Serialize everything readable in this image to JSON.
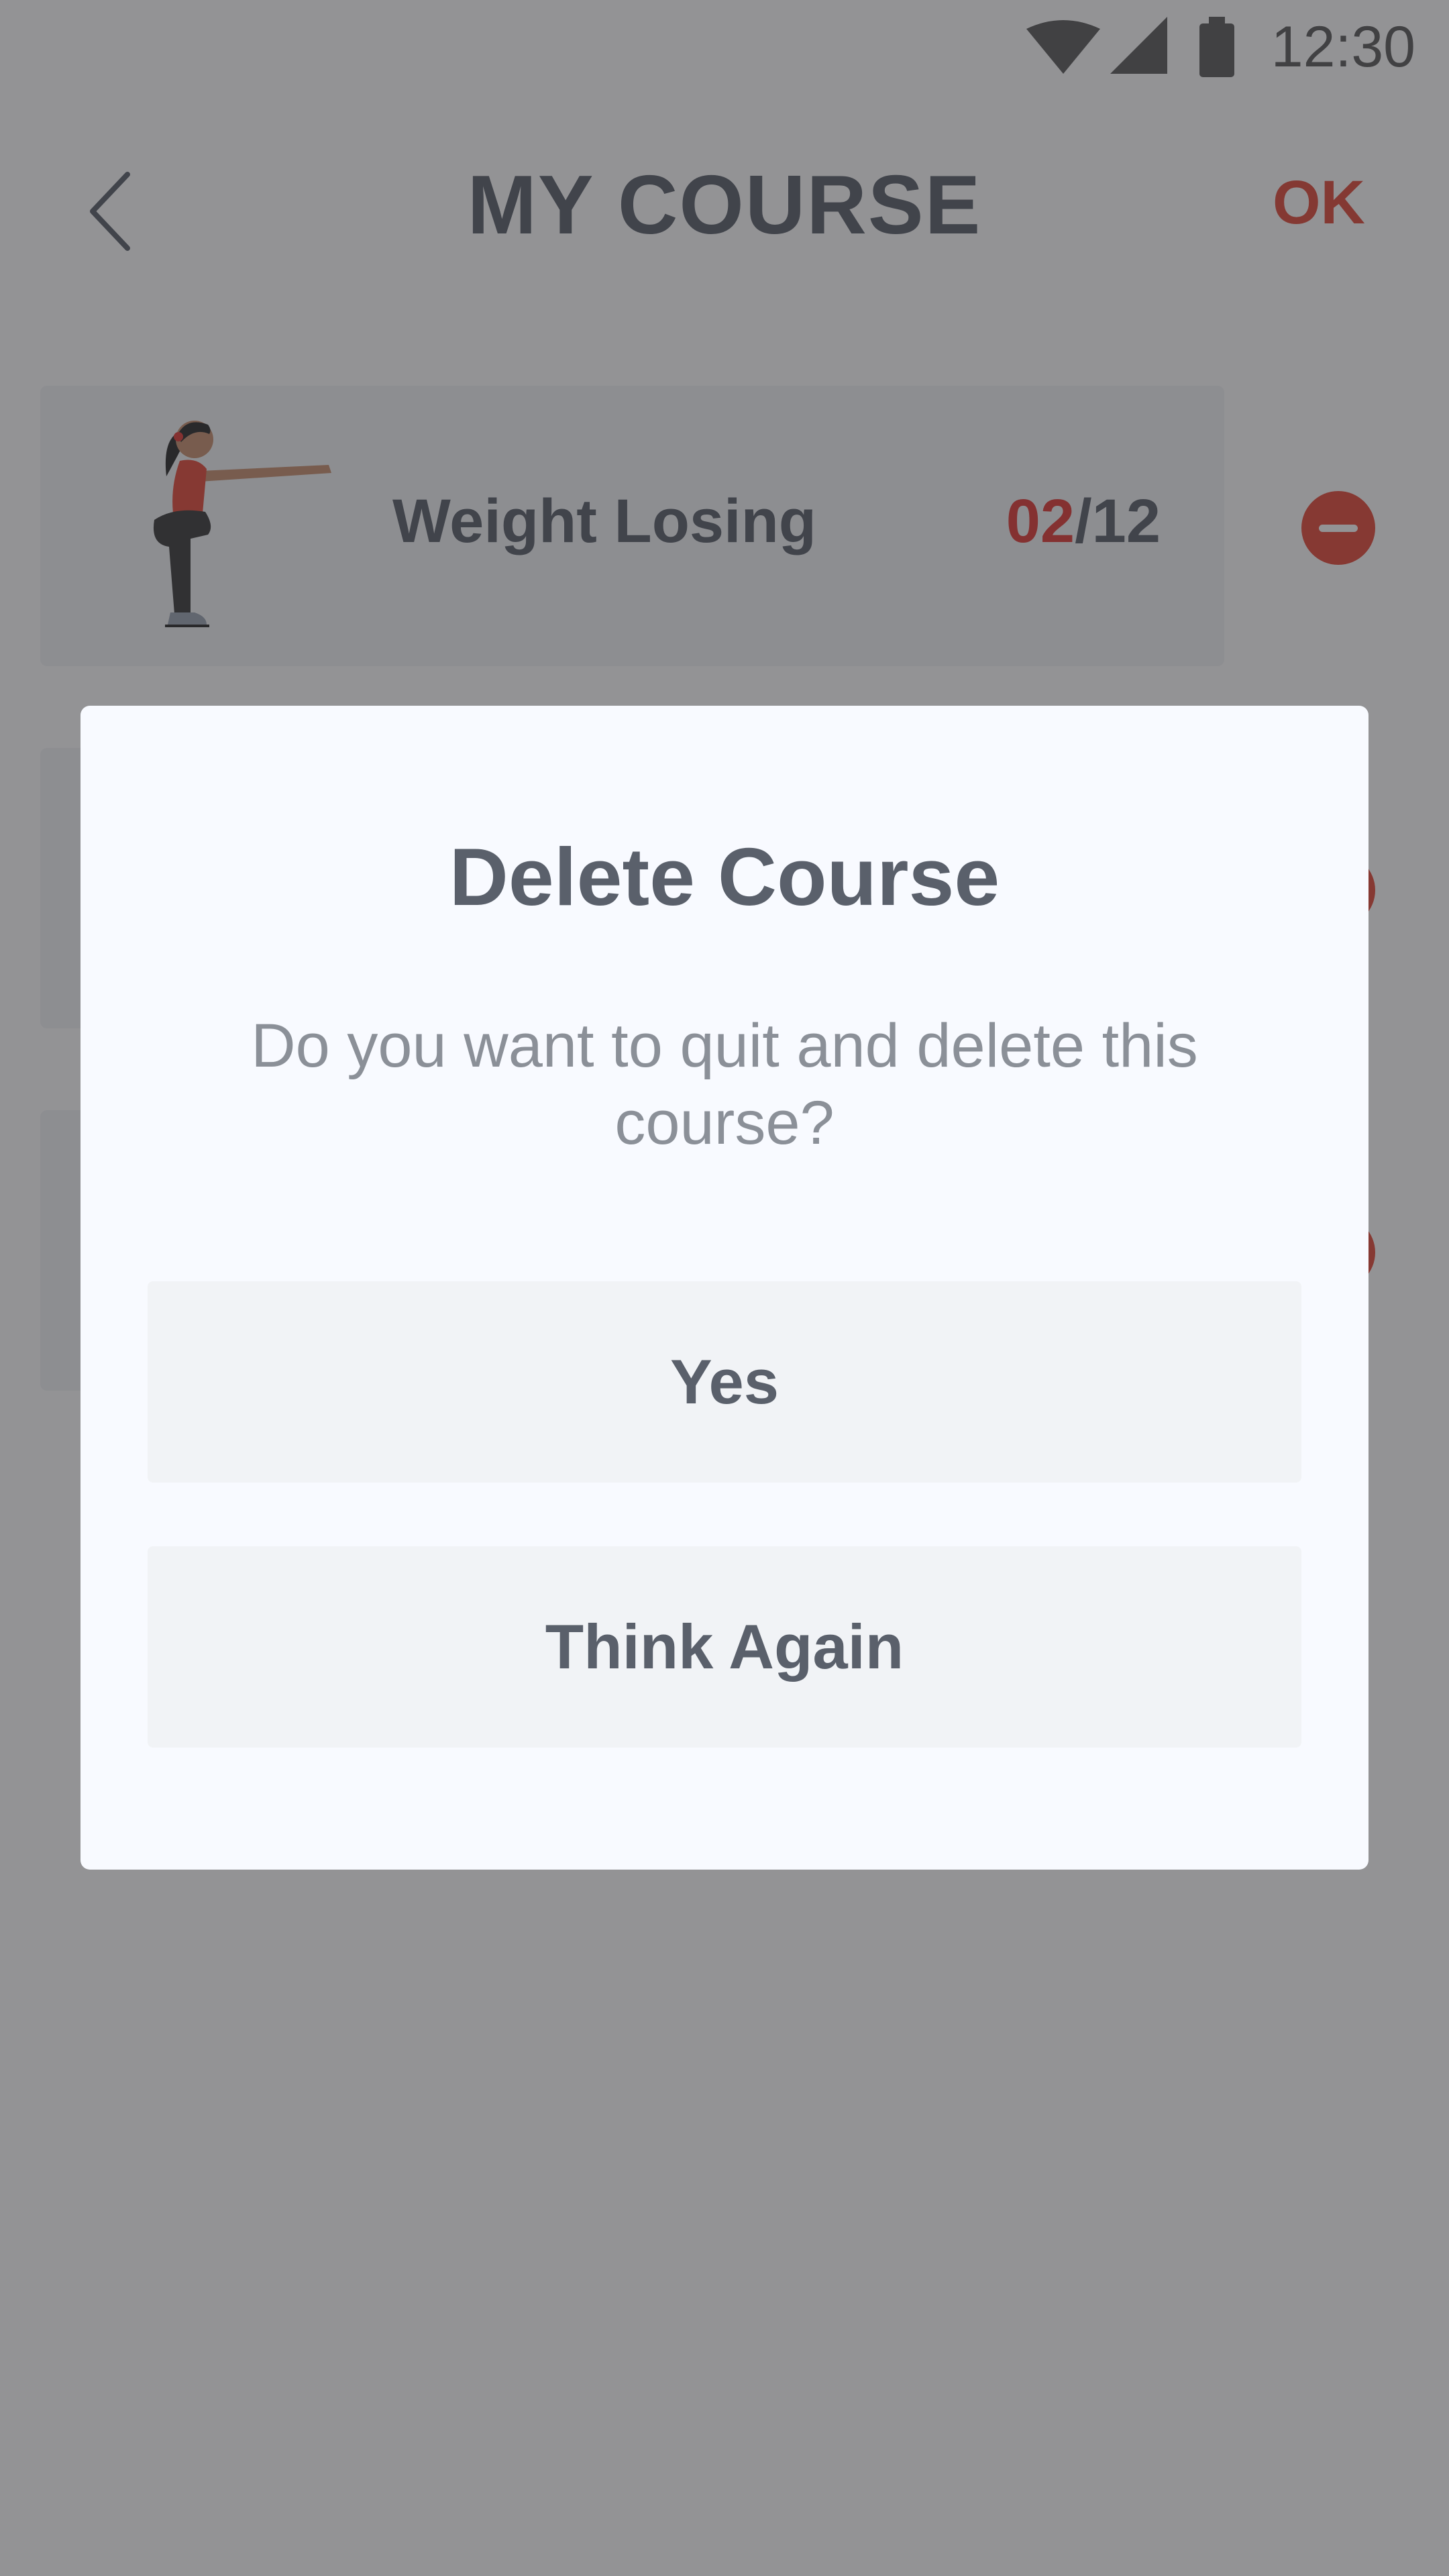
{
  "status_bar": {
    "time": "12:30"
  },
  "header": {
    "title": "MY COURSE",
    "ok_label": "OK"
  },
  "courses": [
    {
      "name": "Weight Losing",
      "progress_current": "02",
      "progress_total": "12"
    }
  ],
  "dialog": {
    "title": "Delete Course",
    "message": "Do you want to quit and delete this course?",
    "yes_label": "Yes",
    "think_again_label": "Think Again"
  },
  "colors": {
    "accent": "#e04a3a",
    "text_primary": "#5a606b",
    "text_secondary": "#8b9098",
    "dialog_background": "#f8faff",
    "button_background": "#f1f3f6"
  }
}
